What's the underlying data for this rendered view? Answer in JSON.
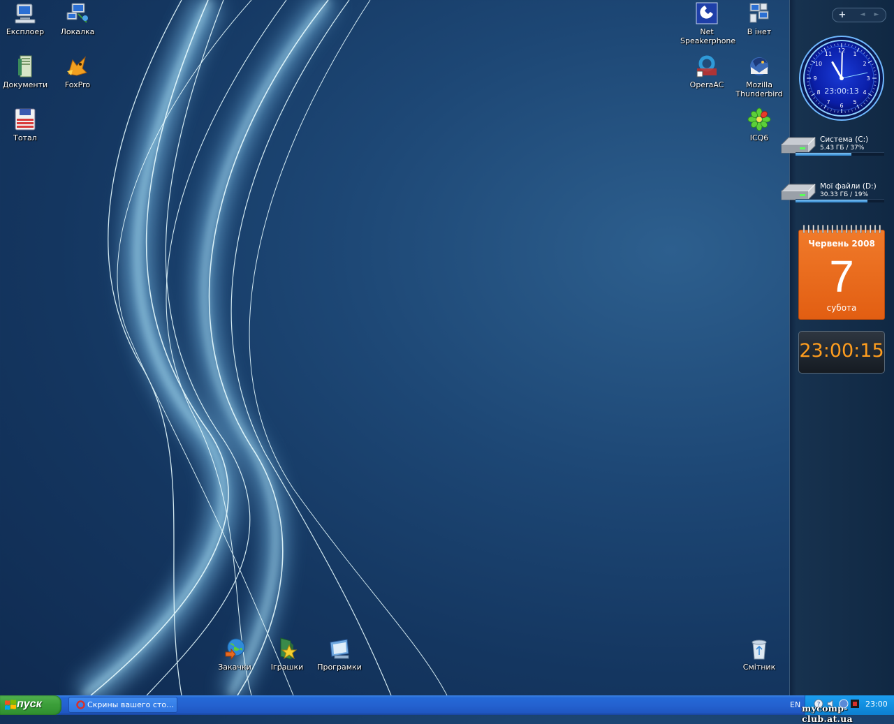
{
  "desktop": {
    "icons": [
      {
        "label": "Експлоер",
        "icon": "my-computer-icon"
      },
      {
        "label": "Локалка",
        "icon": "network-places-icon"
      },
      {
        "label": "Документи",
        "icon": "documents-icon"
      },
      {
        "label": "FoxPro",
        "icon": "foxpro-icon"
      },
      {
        "label": "Тотал",
        "icon": "floppy-disk-icon"
      },
      {
        "label": "Net Speakerphone",
        "icon": "phone-icon"
      },
      {
        "label": "В інет",
        "icon": "internet-connection-icon"
      },
      {
        "label": "OperaAC",
        "icon": "opera-icon"
      },
      {
        "label": "Mozilla Thunderbird",
        "icon": "thunderbird-icon"
      },
      {
        "label": "ICQ6",
        "icon": "icq-flower-icon"
      },
      {
        "label": "Закачки",
        "icon": "downloads-globe-icon"
      },
      {
        "label": "Іграшки",
        "icon": "games-folder-icon"
      },
      {
        "label": "Програмки",
        "icon": "programs-icon"
      },
      {
        "label": "Смітник",
        "icon": "recycle-bin-icon"
      }
    ]
  },
  "sidebar": {
    "add_label": "+",
    "prev_label": "◄",
    "next_label": "►",
    "clock": {
      "digital_time": "23:00:13",
      "hour": 11,
      "minute": 0,
      "second": 13
    },
    "drives": [
      {
        "name": "Система (C:)",
        "info": "5.43 ГБ / 37%",
        "fill_fraction": 0.63
      },
      {
        "name": "Мої файли (D:)",
        "info": "30.33 ГБ / 19%",
        "fill_fraction": 0.81
      }
    ],
    "calendar": {
      "month_year": "Червень 2008",
      "day": "7",
      "weekday": "субота"
    },
    "digital_clock": {
      "time": "23:00:15"
    }
  },
  "taskbar": {
    "start_label": "пуск",
    "task_label": "Скрины вашего сто…",
    "language": "EN",
    "tray_time": "23:00",
    "watermark": "mycomp-club.at.ua"
  },
  "colors": {
    "desktop_bg": "#1d4775",
    "taskbar_blue": "#2462d0",
    "start_green": "#3c9f3a",
    "calendar_orange": "#e86a1e",
    "digital_orange": "#ff9d1e",
    "drive_bar": "#4aa3e8"
  }
}
